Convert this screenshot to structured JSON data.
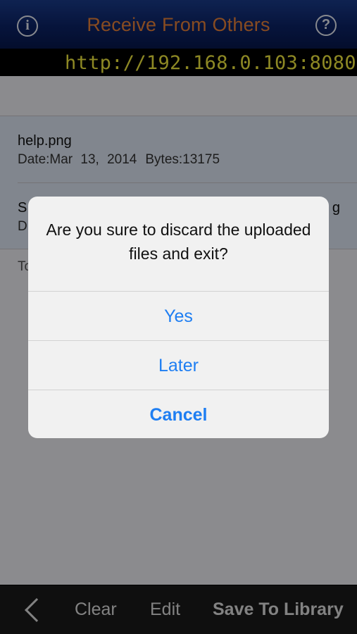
{
  "navbar": {
    "title": "Receive From Others",
    "info_glyph": "i",
    "help_glyph": "?",
    "info_icon": "info-circle-icon",
    "help_icon": "question-circle-icon"
  },
  "url_bar": {
    "url": "http://192.168.0.103:8080"
  },
  "files": [
    {
      "name": "help.png",
      "date": "Date:Mar 13, 2014",
      "bytes": "Bytes:13175"
    },
    {
      "name": "S",
      "date": "D",
      "name_tail": "g"
    }
  ],
  "total_prefix": "To",
  "toolbar": {
    "back_icon": "chevron-left-icon",
    "clear": "Clear",
    "edit": "Edit",
    "save": "Save To Library"
  },
  "alert": {
    "message": "Are you sure to discard the uploaded files and exit?",
    "yes": "Yes",
    "later": "Later",
    "cancel": "Cancel"
  },
  "colors": {
    "nav_title": "#e8823a",
    "url_text": "#f3ea3f",
    "alert_button": "#1e7ef2"
  }
}
